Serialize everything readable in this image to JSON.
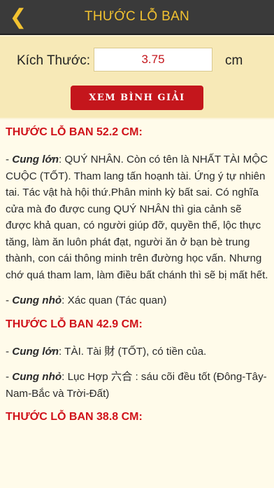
{
  "header": {
    "back_icon": "chevron-left-icon",
    "title": "THƯỚC LỖ BAN"
  },
  "controls": {
    "size_label": "Kích Thước:",
    "size_value": "3.75",
    "unit": "cm",
    "submit_label": "XEM BÌNH GIẢI"
  },
  "colors": {
    "accent_gold": "#f2c230",
    "accent_red": "#c4161c",
    "topbar": "#3a3a3a"
  },
  "results": [
    {
      "title": "THƯỚC LỖ BAN 52.2 CM:",
      "entries": [
        {
          "dash": "- ",
          "term": "Cung lớn",
          "text": ": QUÝ NHÂN. Còn có tên là NHẤT TÀI MỘC CUỘC (TỐT). Tham lang tấn hoạnh tài. Ứng ý tự nhiên tai. Tác vật hà hội thứ.Phân minh kỳ bất sai. Có nghĩa cửa mà đo được cung QUÝ NHÂN thì gia cảnh sẽ được khả quan, có người giúp đỡ, quyền thế, lộc thực tăng, làm ăn luôn phát đạt, người ăn ở bạn bè trung thành, con cái thông minh trên đường học vấn. Nhưng chớ quá tham lam, làm điều bất chánh thì sẽ bị mất hết."
        },
        {
          "dash": "- ",
          "term": "Cung nhỏ",
          "text": ": Xác quan (Tác quan)"
        }
      ]
    },
    {
      "title": "THƯỚC LỖ BAN 42.9 CM:",
      "entries": [
        {
          "dash": "- ",
          "term": "Cung lớn",
          "text": ": TÀI. Tài 財 (TỐT), có tiền của."
        },
        {
          "dash": "- ",
          "term": "Cung nhỏ",
          "text": ": Lục Hợp 六合 : sáu cõi đều tốt (Đông-Tây-Nam-Bắc và Trời-Đất)"
        }
      ]
    },
    {
      "title": "THƯỚC LỖ BAN 38.8 CM:",
      "entries": []
    }
  ]
}
